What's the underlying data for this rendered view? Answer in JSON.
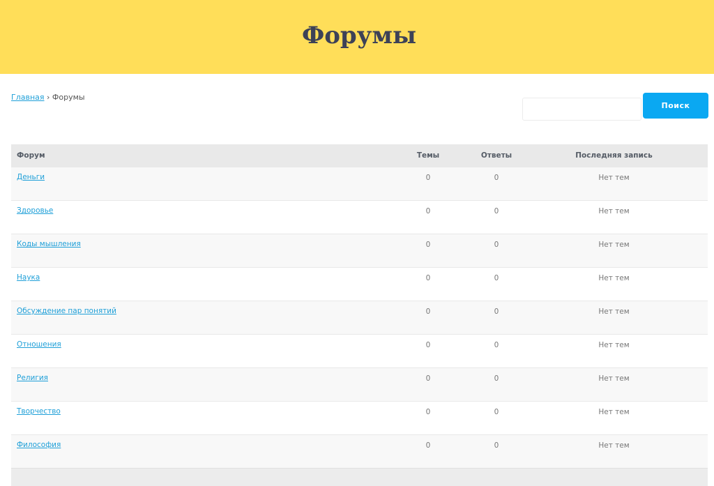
{
  "header": {
    "title": "Форумы"
  },
  "breadcrumb": {
    "home": "Главная",
    "separator": "›",
    "current": "Форумы"
  },
  "search": {
    "button_label": "Поиск",
    "value": ""
  },
  "table": {
    "columns": {
      "forum": "Форум",
      "topics": "Темы",
      "replies": "Ответы",
      "last_post": "Последняя запись"
    },
    "rows": [
      {
        "name": "Деньги",
        "topics": "0",
        "replies": "0",
        "last_post": "Нет тем"
      },
      {
        "name": "Здоровье",
        "topics": "0",
        "replies": "0",
        "last_post": "Нет тем"
      },
      {
        "name": "Коды мышления",
        "topics": "0",
        "replies": "0",
        "last_post": "Нет тем"
      },
      {
        "name": "Наука",
        "topics": "0",
        "replies": "0",
        "last_post": "Нет тем"
      },
      {
        "name": "Обсуждение пар понятий",
        "topics": "0",
        "replies": "0",
        "last_post": "Нет тем"
      },
      {
        "name": "Отношения",
        "topics": "0",
        "replies": "0",
        "last_post": "Нет тем"
      },
      {
        "name": "Религия",
        "topics": "0",
        "replies": "0",
        "last_post": "Нет тем"
      },
      {
        "name": "Творчество",
        "topics": "0",
        "replies": "0",
        "last_post": "Нет тем"
      },
      {
        "name": "Философия",
        "topics": "0",
        "replies": "0",
        "last_post": "Нет тем"
      }
    ]
  },
  "colors": {
    "header_bg": "#ffde59",
    "accent": "#0aa8f2",
    "link": "#1e9fd8",
    "title": "#3d4257"
  }
}
